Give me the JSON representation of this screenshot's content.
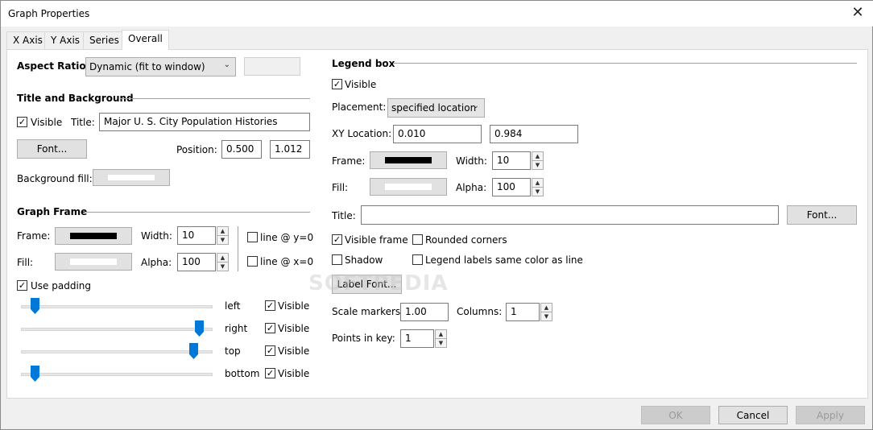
{
  "window": {
    "title": "Graph Properties",
    "close_glyph": "✕"
  },
  "tabs": [
    {
      "label": "X Axis"
    },
    {
      "label": "Y Axis"
    },
    {
      "label": "Series"
    },
    {
      "label": "Overall"
    }
  ],
  "active_tab": "Overall",
  "aspect": {
    "label": "Aspect Ratio:",
    "value": "Dynamic (fit to window)"
  },
  "title_bg": {
    "heading": "Title and Background",
    "visible_label": "Visible",
    "visible_checked": true,
    "title_label": "Title:",
    "title_value": "Major U. S. City Population Histories",
    "font_button": "Font...",
    "position_label": "Position:",
    "position_x": "0.500",
    "position_y": "1.012",
    "bg_fill_label": "Background fill:",
    "bg_fill_color": "#ffffff"
  },
  "graph_frame": {
    "heading": "Graph Frame",
    "frame_label": "Frame:",
    "frame_color": "#000000",
    "width_label": "Width:",
    "width_value": "10",
    "fill_label": "Fill:",
    "fill_color": "#ffffff",
    "alpha_label": "Alpha:",
    "alpha_value": "100",
    "line_y0_label": "line @ y=0",
    "line_y0_checked": false,
    "line_x0_label": "line @ x=0",
    "line_x0_checked": false,
    "use_padding_label": "Use padding",
    "use_padding_checked": true,
    "padding": [
      {
        "side": "left",
        "level": 0.07,
        "visible_label": "Visible",
        "visible": true
      },
      {
        "side": "right",
        "level": 0.93,
        "visible_label": "Visible",
        "visible": true
      },
      {
        "side": "top",
        "level": 0.9,
        "visible_label": "Visible",
        "visible": true
      },
      {
        "side": "bottom",
        "level": 0.07,
        "visible_label": "Visible",
        "visible": true
      }
    ]
  },
  "legend": {
    "heading": "Legend box",
    "visible_label": "Visible",
    "visible_checked": true,
    "placement_label": "Placement:",
    "placement_value": "specified location",
    "xy_label": "XY Location:",
    "x_value": "0.010",
    "y_value": "0.984",
    "frame_label": "Frame:",
    "frame_color": "#000000",
    "width_label": "Width:",
    "width_value": "10",
    "fill_label": "Fill:",
    "fill_color": "#ffffff",
    "alpha_label": "Alpha:",
    "alpha_value": "100",
    "title_label": "Title:",
    "title_value": "",
    "font_button": "Font...",
    "visible_frame_label": "Visible frame",
    "visible_frame_checked": true,
    "rounded_label": "Rounded corners",
    "rounded_checked": false,
    "shadow_label": "Shadow",
    "shadow_checked": false,
    "same_color_label": "Legend labels same color as line",
    "same_color_checked": false,
    "label_font_button": "Label Font...",
    "scale_label": "Scale markers:",
    "scale_value": "1.00",
    "columns_label": "Columns:",
    "columns_value": "1",
    "points_label": "Points in key:",
    "points_value": "1"
  },
  "footer": {
    "ok": "OK",
    "cancel": "Cancel",
    "apply": "Apply"
  },
  "watermark": "SOFTPEDIA",
  "colors": {
    "accent_thumb": "#0078d7"
  }
}
